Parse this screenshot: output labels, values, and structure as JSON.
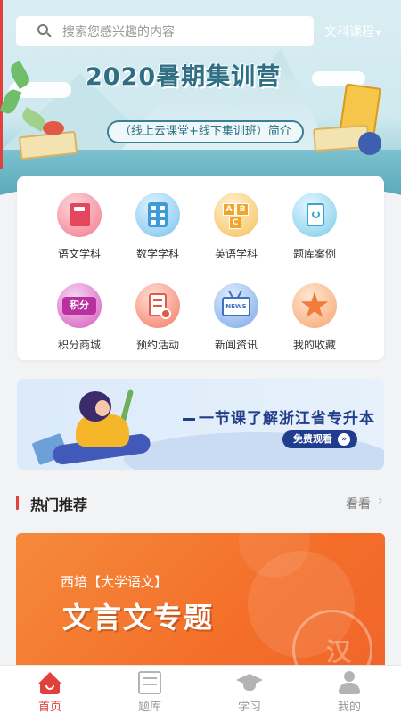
{
  "search": {
    "placeholder": "搜索您感兴趣的内容"
  },
  "category_selector": {
    "label": "文科课程"
  },
  "banner": {
    "title": "2020暑期集训营",
    "subtitle": "（线上云课堂+线下集训班）简介"
  },
  "grid": {
    "items": [
      {
        "label": "语文学科",
        "icon": "chinese-book-icon"
      },
      {
        "label": "数学学科",
        "icon": "calculator-icon"
      },
      {
        "label": "英语学科",
        "icon": "abc-blocks-icon"
      },
      {
        "label": "题库案例",
        "icon": "question-bank-icon"
      },
      {
        "label": "积分商城",
        "icon": "points-icon",
        "icon_text": "积分"
      },
      {
        "label": "预约活动",
        "icon": "booking-icon"
      },
      {
        "label": "新闻资讯",
        "icon": "news-tv-icon",
        "icon_text": "NEWS"
      },
      {
        "label": "我的收藏",
        "icon": "star-icon"
      }
    ]
  },
  "promo": {
    "title": "一节课了解浙江省专升本",
    "button_label": "免费观看"
  },
  "section": {
    "title": "热门推荐",
    "more_label": "看看"
  },
  "course": {
    "tag": "西培【大学语文】",
    "title": "文言文专题",
    "seal_char": "汉"
  },
  "tabbar": {
    "items": [
      {
        "label": "首页",
        "icon": "home-icon",
        "active": true
      },
      {
        "label": "题库",
        "icon": "question-bank-tab-icon",
        "active": false
      },
      {
        "label": "学习",
        "icon": "graduation-cap-icon",
        "active": false
      },
      {
        "label": "我的",
        "icon": "user-icon",
        "active": false
      }
    ]
  },
  "colors": {
    "accent": "#e0413c",
    "promo_navy": "#1f3c8f",
    "course_orange": "#f46f2a"
  }
}
